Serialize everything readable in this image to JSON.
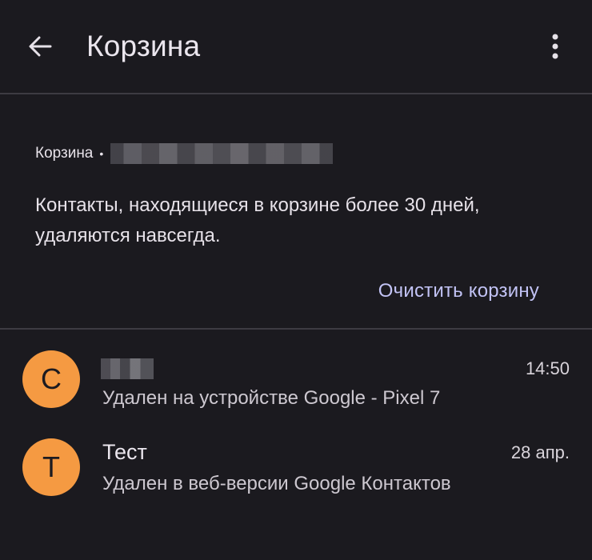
{
  "header": {
    "title": "Корзина",
    "back_icon": "arrow-back-icon",
    "more_icon": "more-vert-icon"
  },
  "info": {
    "account_label": "Корзина",
    "bullet": "•",
    "description": "Контакты, находящиеся в корзине более 30 дней, удаляются навсегда.",
    "empty_button": "Очистить корзину"
  },
  "contacts": [
    {
      "initial": "C",
      "name": "",
      "name_redacted": true,
      "subtitle": "Удален на устройстве Google - Pixel 7",
      "time": "14:50"
    },
    {
      "initial": "Т",
      "name": "Тест",
      "name_redacted": false,
      "subtitle": "Удален в веб-версии Google Контактов",
      "time": "28 апр."
    }
  ],
  "colors": {
    "background": "#1b1a1f",
    "accent_text": "#c2c3f5",
    "avatar": "#f59a42",
    "divider": "#3d3b42"
  }
}
